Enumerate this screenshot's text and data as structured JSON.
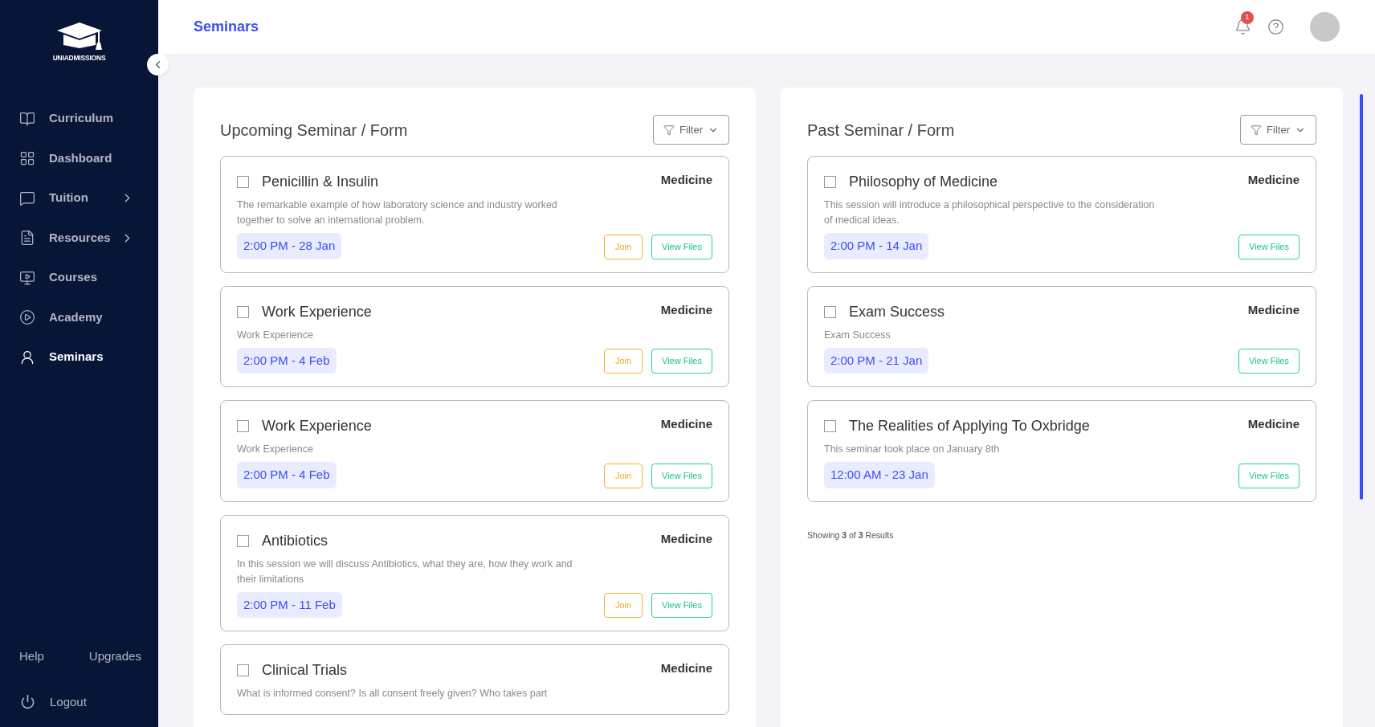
{
  "sidebar": {
    "logo_text": "UNIADMISSIONS",
    "items": [
      {
        "label": "Curriculum",
        "selected": false,
        "expandable": false
      },
      {
        "label": "Dashboard",
        "selected": false,
        "expandable": false
      },
      {
        "label": "Tuition",
        "selected": false,
        "expandable": true
      },
      {
        "label": "Resources",
        "selected": false,
        "expandable": true
      },
      {
        "label": "Courses",
        "selected": false,
        "expandable": false
      },
      {
        "label": "Academy",
        "selected": false,
        "expandable": false
      },
      {
        "label": "Seminars",
        "selected": true,
        "expandable": false
      }
    ],
    "footer_links": [
      "Help",
      "Upgrades"
    ],
    "logout": "Logout"
  },
  "header": {
    "title": "Seminars",
    "notification_count": "1"
  },
  "panels": [
    {
      "title": "Upcoming Seminar / Form",
      "filter": "Filter",
      "seminars": [
        {
          "title": "Penicillin & Insulin",
          "checked": false,
          "subject": "Medicine",
          "description": "The remarkable example of how laboratory science and industry worked together to solve an international problem.",
          "time": "2:00 PM - 28 Jan",
          "join": "Join",
          "view_files": "View Files"
        },
        {
          "title": "Work Experience",
          "checked": false,
          "subject": "Medicine",
          "description": "Work Experience",
          "time": "2:00 PM - 4 Feb",
          "join": "Join",
          "view_files": "View Files"
        },
        {
          "title": "Work Experience",
          "checked": false,
          "subject": "Medicine",
          "description": "Work Experience",
          "time": "2:00 PM - 4 Feb",
          "join": "Join",
          "view_files": "View Files"
        },
        {
          "title": "Antibiotics",
          "checked": false,
          "subject": "Medicine",
          "description": "In this session we will discuss Antibiotics, what they are, how they work and their limitations",
          "time": "2:00 PM - 11 Feb",
          "join": "Join",
          "view_files": "View Files"
        },
        {
          "title": "Clinical Trials",
          "checked": false,
          "subject": "Medicine",
          "description": "What is informed consent? Is all consent freely given? Who takes part"
        }
      ]
    },
    {
      "title": "Past Seminar / Form",
      "filter": "Filter",
      "seminars": [
        {
          "title": "Philosophy of Medicine",
          "checked": false,
          "subject": "Medicine",
          "description": "This session will introduce a philosophical perspective to the consideration of medical ideas.",
          "time": "2:00 PM - 14 Jan",
          "view_files": "View Files"
        },
        {
          "title": "Exam Success",
          "checked": false,
          "subject": "Medicine",
          "description": "Exam Success",
          "time": "2:00 PM - 21 Jan",
          "view_files": "View Files"
        },
        {
          "title": "The Realities of Applying To Oxbridge",
          "checked": false,
          "subject": "Medicine",
          "description": "This seminar took place on January 8th",
          "time": "12:00 AM - 23 Jan",
          "view_files": "View Files"
        }
      ],
      "results": "Showing **3** of **3** Results"
    }
  ]
}
